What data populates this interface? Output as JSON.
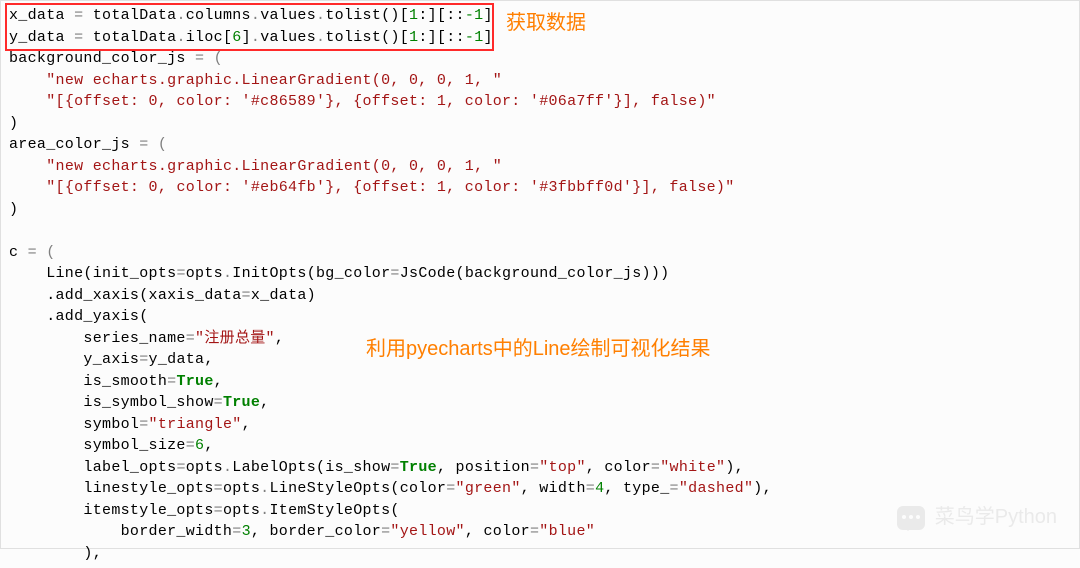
{
  "lines": {
    "l1_var": "x_data",
    "l1_eq": " = ",
    "l1_expr1": "totalData",
    "l1_dot1": ".",
    "l1_attr1": "columns",
    "l1_dot2": ".",
    "l1_attr2": "values",
    "l1_dot3": ".",
    "l1_attr3": "tolist",
    "l1_p": "()[",
    "l1_n1": "1",
    "l1_p2": ":][::",
    "l1_n2": "-1",
    "l1_p3": "]",
    "l2_var": "y_data",
    "l2_eq": " = ",
    "l2_expr1": "totalData",
    "l2_dot1": ".",
    "l2_attr1": "iloc",
    "l2_b1": "[",
    "l2_n0": "6",
    "l2_b2": "]",
    "l2_dot2": ".",
    "l2_attr2": "values",
    "l2_dot3": ".",
    "l2_attr3": "tolist",
    "l2_p": "()[",
    "l2_n1": "1",
    "l2_p2": ":][::",
    "l2_n2": "-1",
    "l2_p3": "]",
    "l3_a": "background_color_js",
    "l3_b": " = (",
    "l4_a": "    ",
    "l4_b": "\"new echarts.graphic.LinearGradient(0, 0, 0, 1, \"",
    "l5_a": "    ",
    "l5_b": "\"[{offset: 0, color: '#c86589'}, {offset: 1, color: '#06a7ff'}], false)\"",
    "l6_a": ")",
    "l7_a": "area_color_js",
    "l7_b": " = (",
    "l8_a": "    ",
    "l8_b": "\"new echarts.graphic.LinearGradient(0, 0, 0, 1, \"",
    "l9_a": "    ",
    "l9_b": "\"[{offset: 0, color: '#eb64fb'}, {offset: 1, color: '#3fbbff0d'}], false)\"",
    "l10_a": ")",
    "l12_a": "c",
    "l12_b": " = (",
    "l13_a": "    Line(init_opts",
    "l13_b": "=",
    "l13_c": "opts",
    "l13_d": ".",
    "l13_e": "InitOpts(bg_color",
    "l13_f": "=",
    "l13_g": "JsCode(background_color_js)))",
    "l14_a": "    .add_xaxis(xaxis_data",
    "l14_b": "=",
    "l14_c": "x_data)",
    "l15_a": "    .add_yaxis(",
    "l16_a": "        series_name",
    "l16_b": "=",
    "l16_c": "\"注册总量\"",
    "l16_d": ",",
    "l17_a": "        y_axis",
    "l17_b": "=",
    "l17_c": "y_data,",
    "l18_a": "        is_smooth",
    "l18_b": "=",
    "l18_c": "True",
    "l18_d": ",",
    "l19_a": "        is_symbol_show",
    "l19_b": "=",
    "l19_c": "True",
    "l19_d": ",",
    "l20_a": "        symbol",
    "l20_b": "=",
    "l20_c": "\"triangle\"",
    "l20_d": ",",
    "l21_a": "        symbol_size",
    "l21_b": "=",
    "l21_c": "6",
    "l21_d": ",",
    "l22_a": "        label_opts",
    "l22_b": "=",
    "l22_c": "opts",
    "l22_d": ".",
    "l22_e": "LabelOpts(is_show",
    "l22_f": "=",
    "l22_g": "True",
    "l22_h": ", position",
    "l22_i": "=",
    "l22_j": "\"top\"",
    "l22_k": ", color",
    "l22_l": "=",
    "l22_m": "\"white\"",
    "l22_n": "),",
    "l23_a": "        linestyle_opts",
    "l23_b": "=",
    "l23_c": "opts",
    "l23_d": ".",
    "l23_e": "LineStyleOpts(color",
    "l23_f": "=",
    "l23_g": "\"green\"",
    "l23_h": ", width",
    "l23_i": "=",
    "l23_j": "4",
    "l23_k": ", type_",
    "l23_l": "=",
    "l23_m": "\"dashed\"",
    "l23_n": "),",
    "l24_a": "        itemstyle_opts",
    "l24_b": "=",
    "l24_c": "opts",
    "l24_d": ".",
    "l24_e": "ItemStyleOpts(",
    "l25_a": "            border_width",
    "l25_b": "=",
    "l25_c": "3",
    "l25_d": ", border_color",
    "l25_e": "=",
    "l25_f": "\"yellow\"",
    "l25_g": ", color",
    "l25_h": "=",
    "l25_i": "\"blue\"",
    "l26_a": "        ),"
  },
  "annotations": {
    "top": "获取数据",
    "middle": "利用pyecharts中的Line绘制可视化结果"
  },
  "watermark": "菜鸟学Python"
}
